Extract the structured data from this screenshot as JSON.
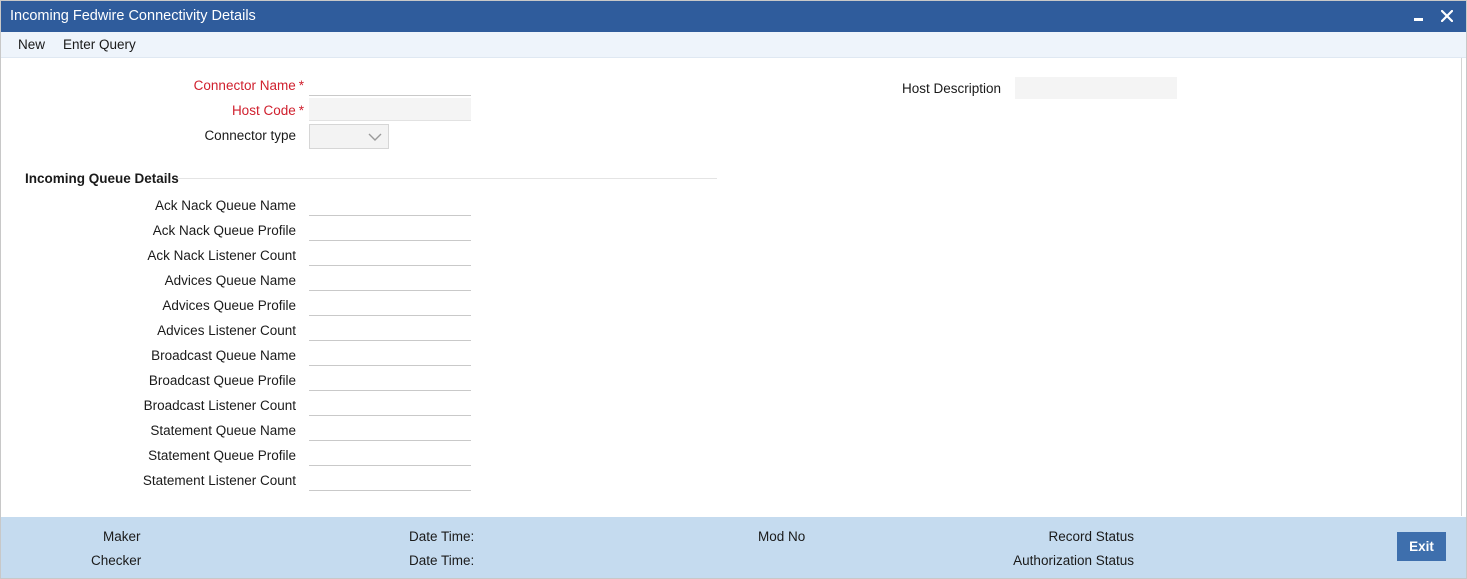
{
  "window": {
    "title": "Incoming Fedwire Connectivity Details",
    "minimize_icon": "minimize-icon",
    "close_icon": "close-icon"
  },
  "menu": {
    "new": "New",
    "enter_query": "Enter Query"
  },
  "header_fields": {
    "connector_name": {
      "label": "Connector Name",
      "required_mark": "*",
      "value": ""
    },
    "host_code": {
      "label": "Host Code",
      "required_mark": "*",
      "value": ""
    },
    "connector_type": {
      "label": "Connector type",
      "value": ""
    },
    "host_description": {
      "label": "Host Description",
      "value": ""
    }
  },
  "incoming_queue": {
    "title": "Incoming Queue Details",
    "fields": [
      {
        "label": "Ack Nack Queue Name",
        "value": ""
      },
      {
        "label": "Ack Nack Queue Profile",
        "value": ""
      },
      {
        "label": "Ack Nack Listener Count",
        "value": ""
      },
      {
        "label": "Advices Queue Name",
        "value": ""
      },
      {
        "label": "Advices Queue Profile",
        "value": ""
      },
      {
        "label": "Advices Listener Count",
        "value": ""
      },
      {
        "label": "Broadcast Queue Name",
        "value": ""
      },
      {
        "label": "Broadcast Queue Profile",
        "value": ""
      },
      {
        "label": "Broadcast Listener Count",
        "value": ""
      },
      {
        "label": "Statement Queue Name",
        "value": ""
      },
      {
        "label": "Statement Queue Profile",
        "value": ""
      },
      {
        "label": "Statement Listener Count",
        "value": ""
      }
    ]
  },
  "footer": {
    "maker": "Maker",
    "checker": "Checker",
    "date_time_1": "Date Time:",
    "date_time_2": "Date Time:",
    "mod_no": "Mod No",
    "record_status": "Record Status",
    "authorization_status": "Authorization Status",
    "exit": "Exit"
  },
  "colors": {
    "titlebar": "#2f5c9c",
    "required_label": "#d0202e",
    "footer": "#c5dbef",
    "exit_button": "#3e6fad"
  }
}
